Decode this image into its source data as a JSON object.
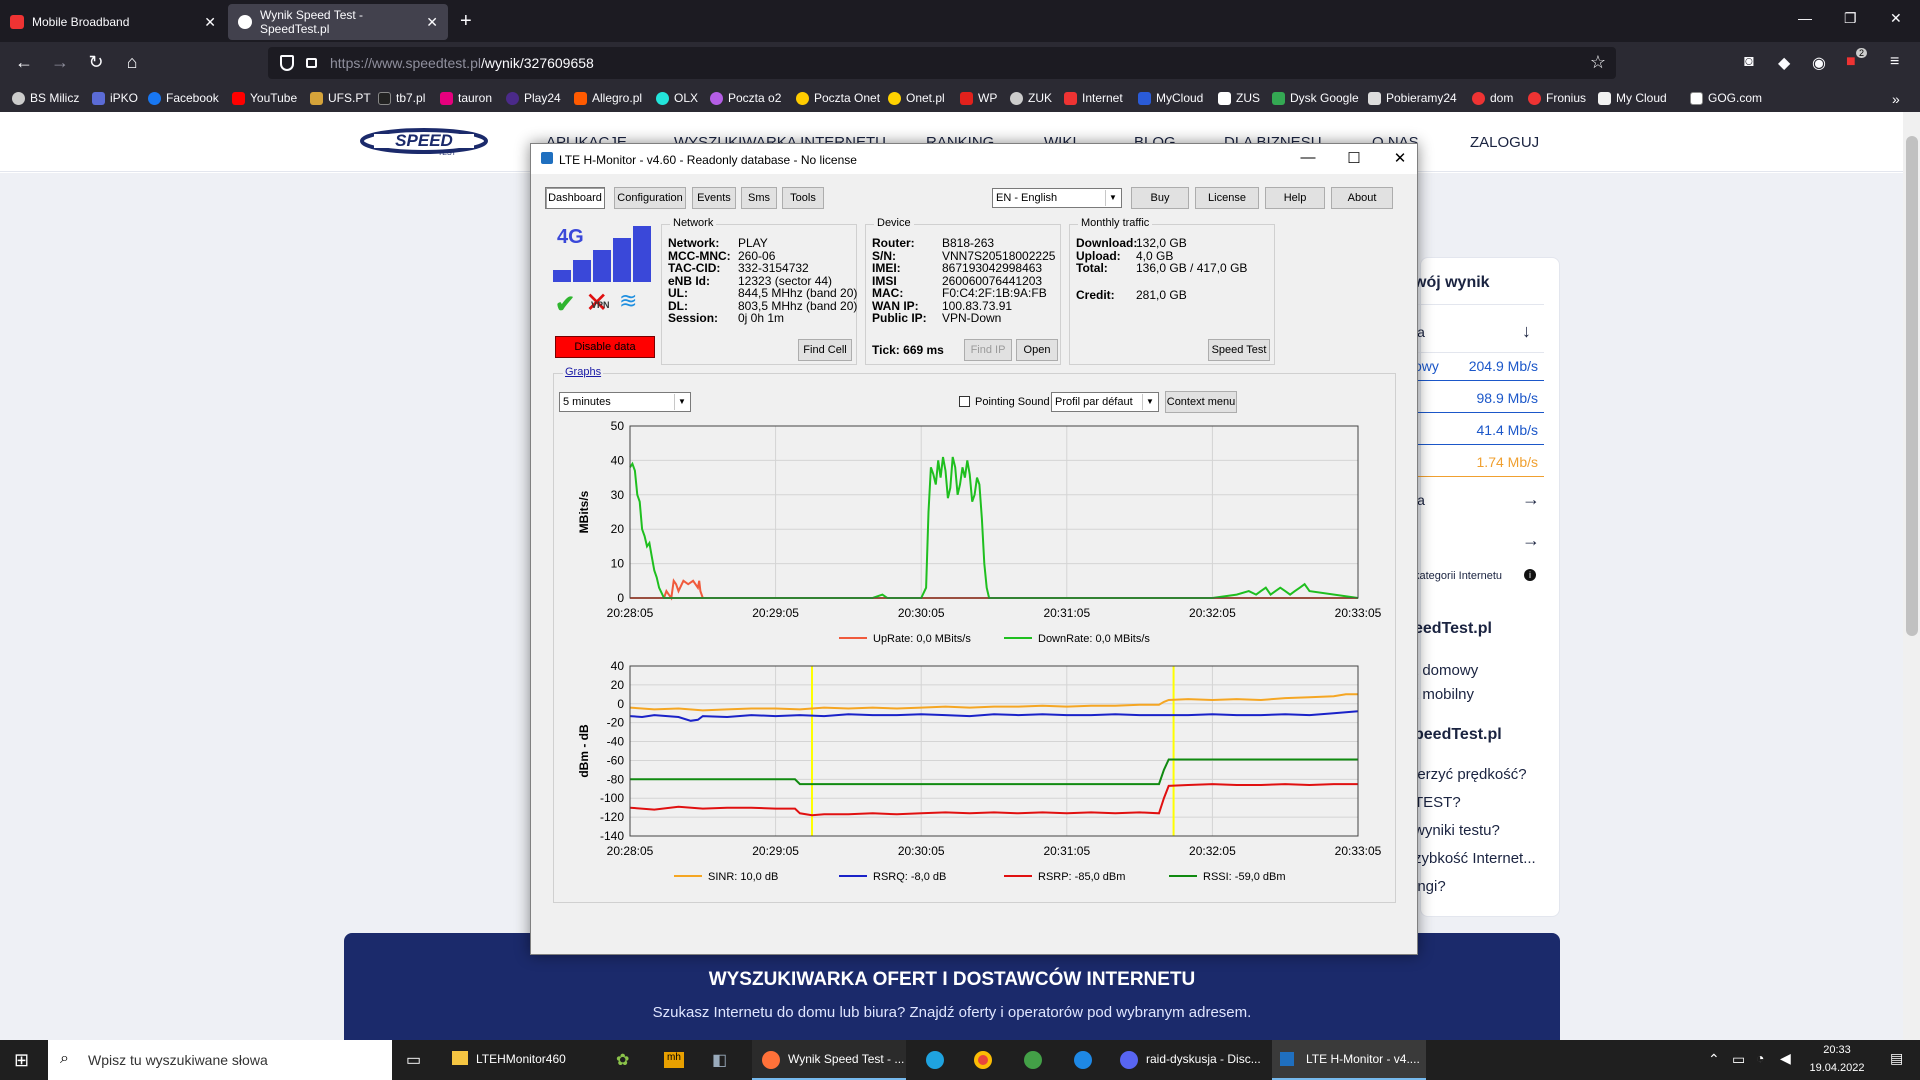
{
  "browser": {
    "tabs": [
      {
        "label": "Mobile Broadband",
        "active": false
      },
      {
        "label": "Wynik Speed Test - SpeedTest.pl",
        "active": true
      }
    ],
    "url_host": "https://www.speedtest.pl",
    "url_path": "/wynik/327609658",
    "bookmarks": [
      "BS Milicz",
      "iPKO",
      "Facebook",
      "YouTube",
      "UFS.PT",
      "tb7.pl",
      "tauron",
      "Play24",
      "Allegro.pl",
      "OLX",
      "Poczta o2",
      "Poczta Onet",
      "Onet.pl",
      "WP",
      "ZUK",
      "Internet",
      "MyCloud",
      "ZUS",
      "Dysk Google",
      "Pobieramy24",
      "dom",
      "Fronius",
      "My Cloud",
      "GOG.com"
    ],
    "extension_badge": "2"
  },
  "site": {
    "nav": [
      "APLIKACJE",
      "WYSZUKIWARKA INTERNETU",
      "RANKING",
      "WIKI",
      "BLOG",
      "DLA BIZNESU",
      "O NAS",
      "ZALOGUJ"
    ],
    "result_title": "wój wynik",
    "rows": [
      {
        "label": "ia"
      },
      {
        "label": "owy",
        "value": "204.9 Mb/s"
      },
      {
        "value": "98.9 Mb/s"
      },
      {
        "value": "41.4 Mb/s"
      },
      {
        "value": "1.74 Mb/s"
      }
    ],
    "row_ia2": "ia",
    "category_note": "kategorii Internetu",
    "h1": "eedTest.pl",
    "line1": "t domowy",
    "line2": "t mobilny",
    "h2": "peedTest.pl",
    "faq": [
      "ierzyć prędkość?",
      "TEST?",
      "wyniki testu?",
      "zybkość Internet...",
      "ingi?"
    ],
    "banner_title": "WYSZUKIWARKA OFERT I DOSTAWCÓW INTERNETU",
    "banner_sub": "Szukasz Internetu do domu lub biura? Znajdź oferty i operatorów pod wybranym adresem."
  },
  "lte": {
    "title": "LTE H-Monitor - v4.60 - Readonly database - No license",
    "tabs": [
      "Dashboard",
      "Configuration",
      "Events",
      "Sms",
      "Tools"
    ],
    "language": "EN - English",
    "top_buttons": [
      "Buy",
      "License",
      "Help",
      "About"
    ],
    "tech": "4G",
    "vpn_label": "VPN",
    "disable_data": "Disable data",
    "network": {
      "title": "Network",
      "rows": [
        {
          "k": "Network:",
          "v": "PLAY"
        },
        {
          "k": "MCC-MNC:",
          "v": "260-06"
        },
        {
          "k": "TAC-CID:",
          "v": "332-3154732"
        },
        {
          "k": "eNB Id:",
          "v": "12323 (sector 44)"
        },
        {
          "k": "UL:",
          "v": "844,5 MHhz (band 20)"
        },
        {
          "k": "DL:",
          "v": "803,5 MHhz (band 20)"
        },
        {
          "k": "Session:",
          "v": "0j 0h 1m"
        }
      ],
      "find_cell": "Find Cell"
    },
    "device": {
      "title": "Device",
      "rows": [
        {
          "k": "Router:",
          "v": "B818-263"
        },
        {
          "k": "S/N:",
          "v": "VNN7S20518002225"
        },
        {
          "k": "IMEI:",
          "v": "867193042998463"
        },
        {
          "k": "IMSI",
          "v": "260060076441203"
        },
        {
          "k": "MAC:",
          "v": "F0:C4:2F:1B:9A:FB"
        },
        {
          "k": "WAN IP:",
          "v": "100.83.73.91"
        },
        {
          "k": "Public IP:",
          "v": "VPN-Down"
        }
      ],
      "tick_label": "Tick:",
      "tick_value": "669 ms",
      "find_ip": "Find IP",
      "open": "Open"
    },
    "traffic": {
      "title": "Monthly traffic",
      "rows": [
        {
          "k": "Download:",
          "v": "132,0 GB"
        },
        {
          "k": "Upload:",
          "v": "4,0 GB"
        },
        {
          "k": "Total:",
          "v": "136,0 GB / 417,0 GB"
        }
      ],
      "credit_k": "Credit:",
      "credit_v": "281,0 GB",
      "speed_test": "Speed Test"
    },
    "graphs_label": "Graphs",
    "range": "5 minutes",
    "pointing_sound": "Pointing Sound",
    "profile": "Profil par défaut",
    "context_menu": "Context menu"
  },
  "chart_data": [
    {
      "type": "line",
      "ylabel": "MBits/s",
      "ylim": [
        0,
        50
      ],
      "yticks": [
        0,
        10,
        20,
        30,
        40,
        50
      ],
      "xticks": [
        "20:28:05",
        "20:29:05",
        "20:30:05",
        "20:31:05",
        "20:32:05",
        "20:33:05"
      ],
      "grid": true,
      "legend_position": "bottom",
      "series": [
        {
          "name": "UpRate: 0,0 MBits/s",
          "color": "#f05a3c",
          "x": [
            0,
            4,
            8,
            10,
            12,
            14,
            15,
            16,
            17,
            18,
            19,
            20,
            22,
            24,
            26,
            28,
            28.5,
            29,
            30,
            36,
            38,
            40,
            42,
            44,
            50,
            53,
            60,
            68,
            70,
            100,
            118,
            120,
            122,
            123,
            124,
            125,
            126,
            127,
            128,
            130,
            131,
            132,
            140,
            142,
            143,
            144,
            145,
            146,
            147,
            148,
            149,
            150,
            151,
            152,
            153,
            154,
            155,
            160,
            200,
            230,
            240,
            242,
            244,
            246,
            248,
            250,
            252,
            256,
            258,
            262,
            264,
            266,
            267,
            268,
            269,
            270,
            271,
            272,
            273,
            274,
            275,
            276,
            277,
            278,
            279,
            280,
            281,
            282,
            283,
            284,
            300
          ],
          "y": [
            0,
            0,
            0,
            0,
            0,
            0,
            2,
            1,
            0,
            5,
            4,
            2,
            5,
            4,
            5,
            3,
            5,
            2,
            0,
            0,
            0,
            0,
            0,
            0,
            0,
            0,
            0,
            0,
            0,
            0,
            0,
            0,
            0,
            0,
            0,
            0,
            0,
            0,
            0,
            0,
            0,
            0,
            0,
            0,
            0,
            0,
            0,
            0,
            0,
            0,
            0,
            0,
            0,
            0,
            0,
            0,
            0,
            0,
            0,
            0,
            0,
            0,
            0,
            0,
            0,
            0,
            0,
            0,
            0,
            0,
            0,
            0,
            0,
            0,
            0,
            0,
            0,
            0,
            0,
            0,
            0,
            0,
            0,
            0,
            0,
            0,
            0,
            0,
            0,
            0,
            0
          ]
        },
        {
          "name": "DownRate: 0,0 MBits/s",
          "color": "#1fbf1f",
          "x": [
            0,
            1,
            2,
            3,
            4,
            5,
            6,
            7,
            8,
            9,
            10,
            11,
            12,
            14,
            16,
            20,
            60,
            100,
            104,
            106,
            110,
            118,
            120,
            122,
            123,
            124,
            125,
            126,
            127,
            128,
            129,
            130,
            131,
            132,
            133,
            134,
            135,
            136,
            137,
            138,
            139,
            140,
            141,
            142,
            143,
            144,
            145,
            146,
            147,
            148,
            150,
            155,
            160,
            200,
            240,
            250,
            255,
            258,
            260,
            262,
            264,
            266,
            268,
            270,
            272,
            274,
            276,
            278,
            280,
            300
          ],
          "y": [
            38,
            39,
            37,
            30,
            28,
            20,
            18,
            15,
            16,
            12,
            8,
            6,
            3,
            0,
            0,
            0,
            0,
            0,
            1,
            0,
            0,
            0,
            0,
            3,
            25,
            38,
            36,
            33,
            40,
            35,
            41,
            37,
            29,
            32,
            41,
            38,
            30,
            33,
            38,
            35,
            40,
            36,
            28,
            30,
            35,
            33,
            23,
            10,
            3,
            0,
            0,
            0,
            0,
            0,
            0,
            1,
            2,
            1,
            2,
            3,
            1,
            2,
            3,
            2,
            1,
            2,
            3,
            4,
            2,
            0
          ]
        }
      ]
    },
    {
      "type": "line",
      "ylabel": "dBm - dB",
      "ylim": [
        -140,
        40
      ],
      "yticks": [
        -140,
        -120,
        -100,
        -80,
        -60,
        -40,
        -20,
        0,
        20,
        40
      ],
      "xticks": [
        "20:28:05",
        "20:29:05",
        "20:30:05",
        "20:31:05",
        "20:32:05",
        "20:33:05"
      ],
      "grid": true,
      "legend_position": "bottom",
      "markers": [
        {
          "x": 75,
          "color": "#ffff00"
        },
        {
          "x": 224,
          "color": "#ffff00"
        }
      ],
      "series": [
        {
          "name": "SINR: 10,0 dB",
          "color": "#f5a623",
          "x": [
            0,
            10,
            20,
            30,
            40,
            50,
            60,
            70,
            80,
            90,
            100,
            110,
            120,
            130,
            140,
            150,
            160,
            170,
            180,
            190,
            200,
            210,
            218,
            220,
            222,
            230,
            240,
            250,
            260,
            270,
            280,
            290,
            295,
            300
          ],
          "y": [
            -4,
            -6,
            -5,
            -7,
            -6,
            -5,
            -5,
            -6,
            -4,
            -5,
            -4,
            -5,
            -4,
            -3,
            -4,
            -3,
            -3,
            -2,
            -3,
            -2,
            -2,
            -1,
            -1,
            2,
            4,
            5,
            4,
            5,
            4,
            6,
            7,
            8,
            10,
            10
          ]
        },
        {
          "name": "RSRQ: -8,0 dB",
          "color": "#1a22c8",
          "x": [
            0,
            5,
            10,
            20,
            25,
            28,
            30,
            40,
            50,
            60,
            70,
            80,
            90,
            100,
            110,
            120,
            130,
            140,
            150,
            160,
            170,
            180,
            190,
            200,
            210,
            220,
            230,
            240,
            250,
            260,
            270,
            280,
            290,
            300
          ],
          "y": [
            -13,
            -14,
            -12,
            -14,
            -18,
            -17,
            -13,
            -14,
            -12,
            -13,
            -12,
            -13,
            -11,
            -12,
            -12,
            -11,
            -12,
            -13,
            -11,
            -12,
            -11,
            -12,
            -12,
            -11,
            -12,
            -12,
            -12,
            -11,
            -12,
            -12,
            -11,
            -12,
            -10,
            -8
          ]
        },
        {
          "name": "RSRP: -85,0 dBm",
          "color": "#e01010",
          "x": [
            0,
            10,
            20,
            30,
            40,
            50,
            60,
            68,
            70,
            75,
            80,
            90,
            100,
            110,
            120,
            130,
            140,
            150,
            160,
            170,
            180,
            190,
            200,
            210,
            218,
            220,
            222,
            230,
            240,
            250,
            260,
            270,
            280,
            290,
            300
          ],
          "y": [
            -110,
            -112,
            -109,
            -111,
            -110,
            -110,
            -111,
            -111,
            -116,
            -118,
            -117,
            -117,
            -116,
            -117,
            -116,
            -115,
            -116,
            -115,
            -116,
            -115,
            -116,
            -115,
            -116,
            -115,
            -116,
            -100,
            -87,
            -86,
            -85,
            -86,
            -86,
            -85,
            -86,
            -85,
            -85
          ]
        },
        {
          "name": "RSSI: -59,0 dBm",
          "color": "#108a10",
          "x": [
            0,
            10,
            20,
            30,
            40,
            50,
            60,
            68,
            70,
            75,
            80,
            100,
            120,
            140,
            160,
            180,
            200,
            218,
            220,
            222,
            230,
            250,
            270,
            290,
            300
          ],
          "y": [
            -80,
            -80,
            -80,
            -80,
            -80,
            -80,
            -80,
            -80,
            -85,
            -85,
            -85,
            -85,
            -85,
            -85,
            -85,
            -85,
            -85,
            -85,
            -70,
            -59,
            -59,
            -59,
            -59,
            -59,
            -59
          ]
        }
      ]
    }
  ],
  "taskbar": {
    "search_placeholder": "Wpisz tu wyszukiwane słowa",
    "apps": [
      {
        "label": "LTEHMonitor460"
      },
      {
        "label": "Wynik Speed Test - ..."
      },
      {
        "label": "raid-dyskusja - Disc..."
      },
      {
        "label": "LTE H-Monitor - v4...."
      }
    ],
    "time": "20:33",
    "date": "19.04.2022"
  }
}
